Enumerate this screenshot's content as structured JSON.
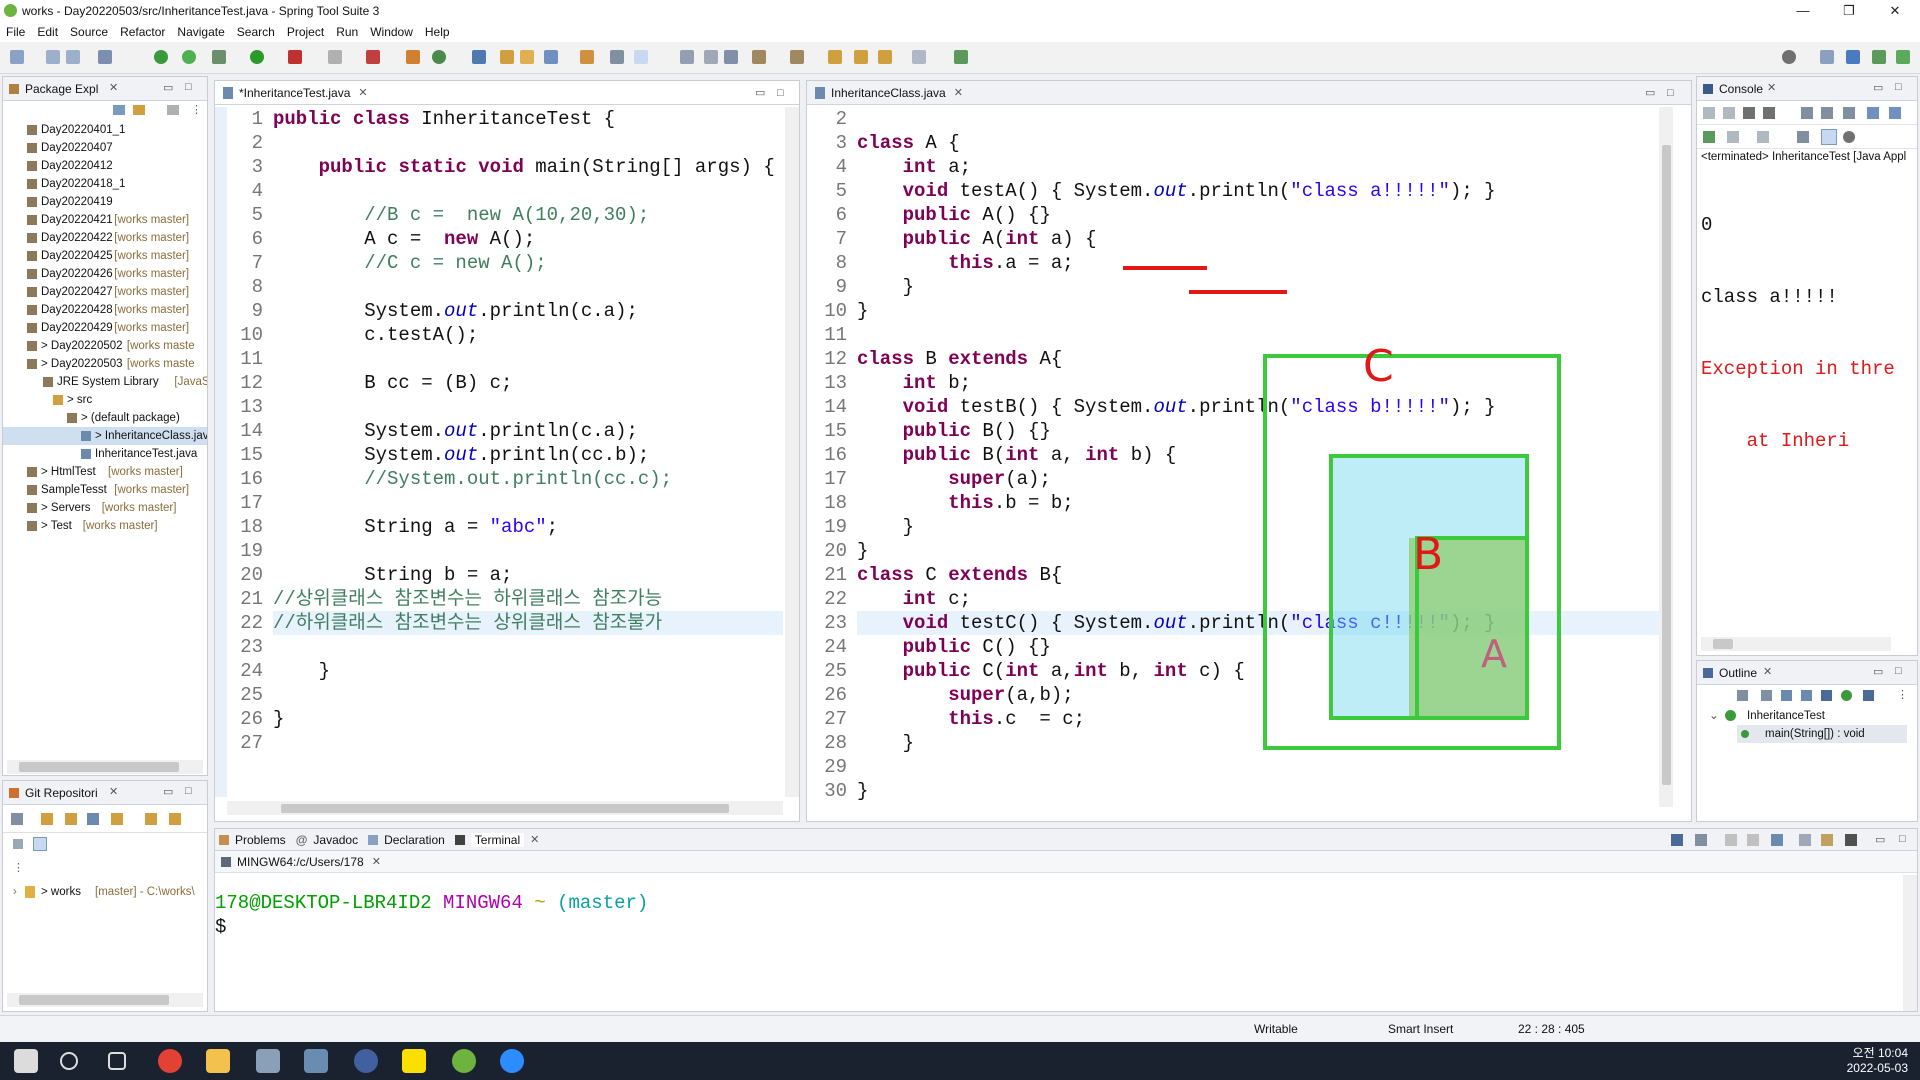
{
  "window": {
    "title": "works - Day20220503/src/InheritanceTest.java - Spring Tool Suite 3",
    "controls": [
      "—",
      "❐",
      "✕"
    ]
  },
  "menu": [
    "File",
    "Edit",
    "Source",
    "Refactor",
    "Navigate",
    "Search",
    "Project",
    "Run",
    "Window",
    "Help"
  ],
  "package_explorer": {
    "tab": "Package Expl",
    "items": [
      {
        "label": "Day20220401_1",
        "git": ""
      },
      {
        "label": "Day20220407",
        "git": ""
      },
      {
        "label": "Day20220412",
        "git": ""
      },
      {
        "label": "Day20220418_1",
        "git": ""
      },
      {
        "label": "Day20220419",
        "git": ""
      },
      {
        "label": "Day20220421",
        "git": "[works master]"
      },
      {
        "label": "Day20220422",
        "git": "[works master]"
      },
      {
        "label": "Day20220425",
        "git": "[works master]"
      },
      {
        "label": "Day20220426",
        "git": "[works master]"
      },
      {
        "label": "Day20220427",
        "git": "[works master]"
      },
      {
        "label": "Day20220428",
        "git": "[works master]"
      },
      {
        "label": "Day20220429",
        "git": "[works master]"
      },
      {
        "label": "> Day20220502",
        "git": "[works maste"
      },
      {
        "label": "> Day20220503",
        "git": "[works maste"
      },
      {
        "label": "JRE System Library",
        "git": "[JavaSE"
      },
      {
        "label": "> src",
        "git": ""
      },
      {
        "label": "> (default package)",
        "git": ""
      },
      {
        "label": "> InheritanceClass.java",
        "git": ""
      },
      {
        "label": "InheritanceTest.java",
        "git": ""
      },
      {
        "label": "> HtmlTest",
        "git": "[works master]"
      },
      {
        "label": "SampleTesst",
        "git": "[works master]"
      },
      {
        "label": "> Servers",
        "git": "[works master]"
      },
      {
        "label": "> Test",
        "git": "[works master]"
      }
    ]
  },
  "git_repos": {
    "tab": "Git Repositori",
    "item": "> works",
    "item_git": "[master] - C:\\works\\"
  },
  "editor_left": {
    "tab": "*InheritanceTest.java",
    "lines": [
      {
        "n": "1",
        "t": "public class InheritanceTest {"
      },
      {
        "n": "2",
        "t": ""
      },
      {
        "n": "3",
        "t": "    public static void main(String[] args) {"
      },
      {
        "n": "4",
        "t": ""
      },
      {
        "n": "5",
        "t": "        //B c =  new A(10,20,30);"
      },
      {
        "n": "6",
        "t": "        A c =  new A();"
      },
      {
        "n": "7",
        "t": "        //C c = new A();"
      },
      {
        "n": "8",
        "t": ""
      },
      {
        "n": "9",
        "t": "        System.out.println(c.a);"
      },
      {
        "n": "10",
        "t": "        c.testA();"
      },
      {
        "n": "11",
        "t": ""
      },
      {
        "n": "12",
        "t": "        B cc = (B) c;"
      },
      {
        "n": "13",
        "t": ""
      },
      {
        "n": "14",
        "t": "        System.out.println(c.a);"
      },
      {
        "n": "15",
        "t": "        System.out.println(cc.b);"
      },
      {
        "n": "16",
        "t": "        //System.out.println(cc.c);"
      },
      {
        "n": "17",
        "t": ""
      },
      {
        "n": "18",
        "t": "        String a = \"abc\";"
      },
      {
        "n": "19",
        "t": ""
      },
      {
        "n": "20",
        "t": "        String b = a;"
      },
      {
        "n": "21",
        "t": "//상위클래스 참조변수는 하위클래스 참조가능"
      },
      {
        "n": "22",
        "t": "//하위클래스 참조변수는 상위클래스 참조불가"
      },
      {
        "n": "23",
        "t": ""
      },
      {
        "n": "24",
        "t": "    }"
      },
      {
        "n": "25",
        "t": ""
      },
      {
        "n": "26",
        "t": "}"
      },
      {
        "n": "27",
        "t": ""
      }
    ]
  },
  "editor_right": {
    "tab": "InheritanceClass.java",
    "lines": [
      {
        "n": "2",
        "t": ""
      },
      {
        "n": "3",
        "t": "class A {"
      },
      {
        "n": "4",
        "t": "    int a;"
      },
      {
        "n": "5",
        "t": "    void testA() { System.out.println(\"class a!!!!!\"); }"
      },
      {
        "n": "6",
        "t": "    public A() {}"
      },
      {
        "n": "7",
        "t": "    public A(int a) {"
      },
      {
        "n": "8",
        "t": "        this.a = a;"
      },
      {
        "n": "9",
        "t": "    }"
      },
      {
        "n": "10",
        "t": "}"
      },
      {
        "n": "11",
        "t": ""
      },
      {
        "n": "12",
        "t": "class B extends A{"
      },
      {
        "n": "13",
        "t": "    int b;"
      },
      {
        "n": "14",
        "t": "    void testB() { System.out.println(\"class b!!!!!\"); }"
      },
      {
        "n": "15",
        "t": "    public B() {}"
      },
      {
        "n": "16",
        "t": "    public B(int a, int b) {"
      },
      {
        "n": "17",
        "t": "        super(a);"
      },
      {
        "n": "18",
        "t": "        this.b = b;"
      },
      {
        "n": "19",
        "t": "    }"
      },
      {
        "n": "20",
        "t": "}"
      },
      {
        "n": "21",
        "t": "class C extends B{"
      },
      {
        "n": "22",
        "t": "    int c;"
      },
      {
        "n": "23",
        "t": "    void testC() { System.out.println(\"class c!!!!!\"); }"
      },
      {
        "n": "24",
        "t": "    public C() {}"
      },
      {
        "n": "25",
        "t": "    public C(int a,int b, int c) {"
      },
      {
        "n": "26",
        "t": "        super(a,b);"
      },
      {
        "n": "27",
        "t": "        this.c  = c;"
      },
      {
        "n": "28",
        "t": "    }"
      },
      {
        "n": "29",
        "t": ""
      },
      {
        "n": "30",
        "t": "}"
      }
    ],
    "annotations": [
      "C",
      "B",
      "A"
    ]
  },
  "console": {
    "tab": "Console",
    "status": "<terminated> InheritanceTest [Java Appl",
    "lines": [
      "0",
      "class a!!!!!",
      "Exception in thre",
      "    at Inheri"
    ]
  },
  "outline": {
    "tab": "Outline",
    "class": "InheritanceTest",
    "method": "main(String[]) : void"
  },
  "bottom_tabs": [
    "Problems",
    "Javadoc",
    "Declaration",
    "Terminal"
  ],
  "terminal": {
    "tab": "MINGW64:/c/Users/178",
    "prompt_user": "178@DESKTOP-LBR4ID2",
    "prompt_env": "MINGW64",
    "prompt_dir": "~",
    "prompt_branch": "(master)",
    "cursor_line": "$"
  },
  "statusbar": {
    "mode": "Writable",
    "insert": "Smart Insert",
    "position": "22 : 28 : 405"
  },
  "tray": {
    "time": "오전 10:04",
    "date": "2022-05-03"
  },
  "colors": {
    "annotation_green": "#3cc93c",
    "annotation_blue": "#6fd6f0",
    "annotation_red": "#e01818",
    "terminal_green": "#00a000",
    "terminal_magenta": "#b000b0",
    "terminal_cyan": "#0aa0a0"
  }
}
